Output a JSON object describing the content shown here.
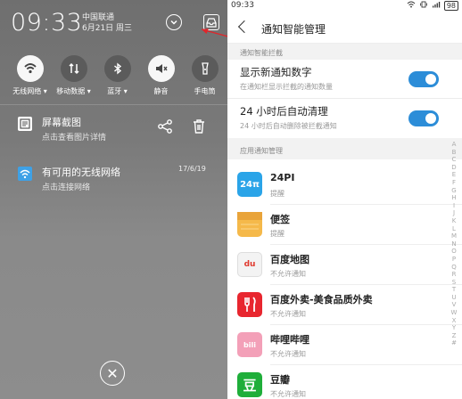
{
  "shade": {
    "time": "09:33",
    "carrier": "中国联通",
    "date": "6月21日 周三",
    "tiles": [
      {
        "label": "无线网络 ▾",
        "icon": "wifi-icon",
        "on": true
      },
      {
        "label": "移动数据 ▾",
        "icon": "mobile-data-icon",
        "on": false
      },
      {
        "label": "蓝牙 ▾",
        "icon": "bluetooth-icon",
        "on": false
      },
      {
        "label": "静音",
        "icon": "mute-icon",
        "on": true
      },
      {
        "label": "手电筒",
        "icon": "flashlight-icon",
        "on": false
      }
    ],
    "notifications": [
      {
        "title": "屏幕截图",
        "subtitle": "点击查看图片详情"
      },
      {
        "title": "有可用的无线网络",
        "subtitle": "点击连接网络",
        "time": "17/6/19"
      }
    ],
    "close_glyph": "✕"
  },
  "statusbar": {
    "time": "09:33",
    "battery": "98"
  },
  "header": {
    "title": "通知智能管理"
  },
  "sections": {
    "interception": "通知智能拦截",
    "apps": "应用通知管理"
  },
  "settings": [
    {
      "title": "显示新通知数字",
      "subtitle": "在通知栏显示拦截的通知数量",
      "enabled": true
    },
    {
      "title": "24 小时后自动清理",
      "subtitle": "24 小时后自动删除被拦截通知",
      "enabled": true
    }
  ],
  "apps": [
    {
      "name": "24PI",
      "status": "提醒",
      "icon": "24pi-icon",
      "color": "#2aa4e8",
      "glyph": "24π"
    },
    {
      "name": "便签",
      "status": "提醒",
      "icon": "notes-icon",
      "color": "#f5b94a",
      "glyph": ""
    },
    {
      "name": "百度地图",
      "status": "不允许通知",
      "icon": "baidu-map-icon",
      "color": "#f3f3f3",
      "glyph": "du"
    },
    {
      "name": "百度外卖-美食品质外卖",
      "status": "不允许通知",
      "icon": "baidu-waimai-icon",
      "color": "#e8262f",
      "glyph": "🍴"
    },
    {
      "name": "哔哩哔哩",
      "status": "不允许通知",
      "icon": "bilibili-icon",
      "color": "#f3a0b8",
      "glyph": "bili"
    },
    {
      "name": "豆瓣",
      "status": "不允许通知",
      "icon": "douban-icon",
      "color": "#1fae3a",
      "glyph": "豆"
    }
  ],
  "index_letters": [
    "A",
    "B",
    "C",
    "D",
    "E",
    "F",
    "G",
    "H",
    "I",
    "J",
    "K",
    "L",
    "M",
    "N",
    "O",
    "P",
    "Q",
    "R",
    "S",
    "T",
    "U",
    "V",
    "W",
    "X",
    "Y",
    "Z",
    "#"
  ],
  "colors": {
    "toggle_on": "#2c8dd8",
    "arrow": "#e0262b"
  }
}
